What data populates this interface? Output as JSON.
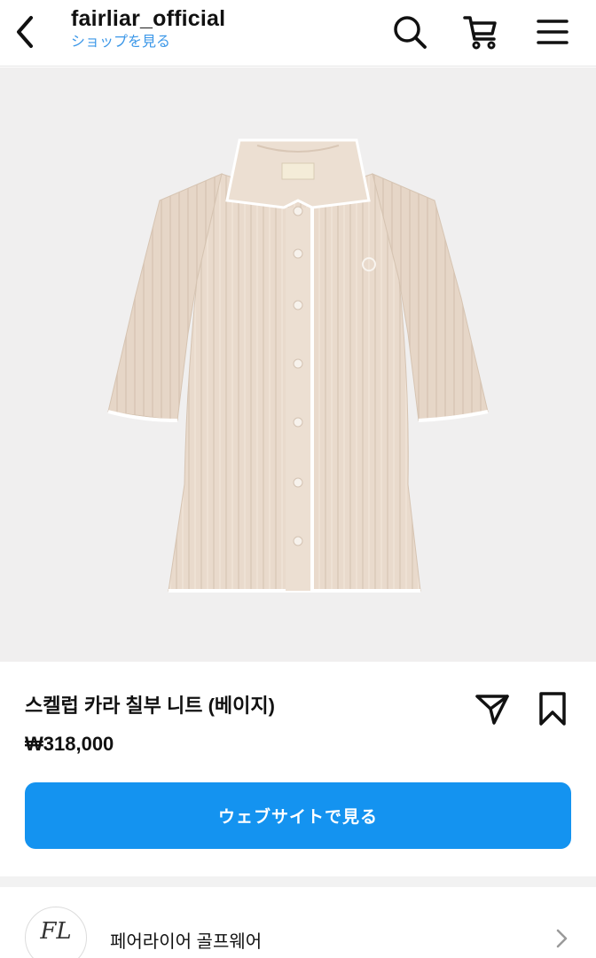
{
  "header": {
    "account_name": "fairliar_official",
    "shop_link": "ショップを見る"
  },
  "product": {
    "name": "스켈럽 카라 칠부 니트 (베이지)",
    "price": "₩318,000",
    "cta_label": "ウェブサイトで見る"
  },
  "shop": {
    "name": "페어라이어 골프웨어",
    "logo_text": "FL"
  },
  "colors": {
    "accent": "#1493f0",
    "link": "#3b97e8",
    "garment": "#e8d9cb"
  },
  "icons": [
    "back-arrow-icon",
    "search-icon",
    "cart-icon",
    "menu-icon",
    "share-icon",
    "bookmark-icon",
    "chevron-right-icon"
  ]
}
